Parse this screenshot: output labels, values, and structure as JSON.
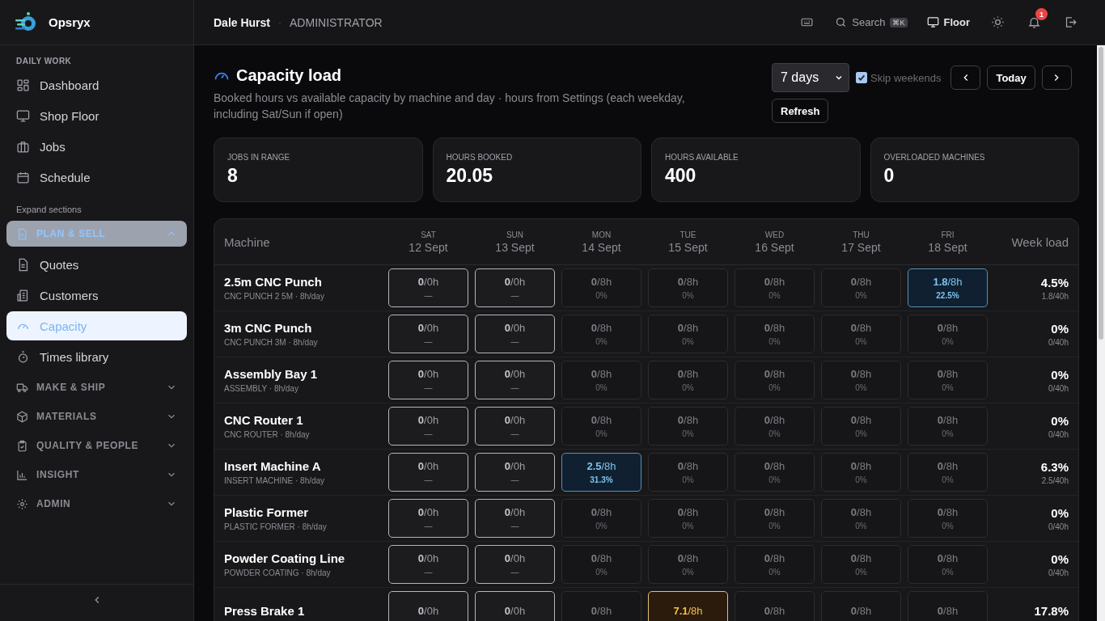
{
  "sidebar": {
    "brand": "Opsryx",
    "daily": {
      "heading": "DAILY WORK",
      "items": [
        {
          "label": "Dashboard",
          "selected": false
        },
        {
          "label": "Shop Floor",
          "selected": false
        },
        {
          "label": "Jobs",
          "selected": false
        },
        {
          "label": "Schedule",
          "selected": false
        }
      ]
    },
    "expand_label": "Expand sections",
    "sections": [
      {
        "label": "PLAN & SELL",
        "expanded": true,
        "items": [
          {
            "label": "Quotes",
            "selected": false
          },
          {
            "label": "Customers",
            "selected": false
          },
          {
            "label": "Capacity",
            "selected": true
          },
          {
            "label": "Times library",
            "selected": false
          }
        ]
      },
      {
        "label": "MAKE & SHIP",
        "expanded": false
      },
      {
        "label": "MATERIALS",
        "expanded": false
      },
      {
        "label": "QUALITY & PEOPLE",
        "expanded": false
      },
      {
        "label": "INSIGHT",
        "expanded": false
      },
      {
        "label": "ADMIN",
        "expanded": false
      }
    ]
  },
  "topbar": {
    "user": "Dale Hurst",
    "separator": "·",
    "role": "ADMINISTRATOR",
    "search": "Search",
    "shortcut": "⌘K",
    "floor": "Floor",
    "notifications": "1"
  },
  "page": {
    "title": "Capacity load",
    "subtitle": "Booked hours vs available capacity by machine and day · hours from Settings (each weekday, including Sat/Sun if open)",
    "range": "7 days",
    "skip_weekends": {
      "label": "Skip weekends",
      "checked": true
    },
    "today": "Today",
    "refresh": "Refresh"
  },
  "stats": [
    {
      "label": "JOBS IN RANGE",
      "value": "8"
    },
    {
      "label": "HOURS BOOKED",
      "value": "20.05"
    },
    {
      "label": "HOURS AVAILABLE",
      "value": "400"
    },
    {
      "label": "OVERLOADED MACHINES",
      "value": "0"
    }
  ],
  "table": {
    "machine_heading": "Machine",
    "load_heading": "Week load",
    "days": [
      {
        "weekday": "SAT",
        "date": "12 Sept"
      },
      {
        "weekday": "SUN",
        "date": "13 Sept"
      },
      {
        "weekday": "MON",
        "date": "14 Sept"
      },
      {
        "weekday": "TUE",
        "date": "15 Sept"
      },
      {
        "weekday": "WED",
        "date": "16 Sept"
      },
      {
        "weekday": "THU",
        "date": "17 Sept"
      },
      {
        "weekday": "FRI",
        "date": "18 Sept"
      }
    ],
    "rows": [
      {
        "name": "2.5m CNC Punch",
        "detail": "CNC PUNCH 2 5M · 8h/day",
        "load": "4.5%",
        "load_detail": "1.8/40h",
        "cells": [
          {
            "kind": "closed",
            "booked": "0",
            "capacity": "/0h",
            "sub": "—"
          },
          {
            "kind": "closed",
            "booked": "0",
            "capacity": "/0h",
            "sub": "—"
          },
          {
            "kind": "idle",
            "booked": "0",
            "capacity": "/8h",
            "sub": "0%"
          },
          {
            "kind": "idle",
            "booked": "0",
            "capacity": "/8h",
            "sub": "0%"
          },
          {
            "kind": "idle",
            "booked": "0",
            "capacity": "/8h",
            "sub": "0%"
          },
          {
            "kind": "idle",
            "booked": "0",
            "capacity": "/8h",
            "sub": "0%"
          },
          {
            "kind": "booked",
            "booked": "1.8",
            "capacity": "/8h",
            "sub": "22.5%"
          }
        ]
      },
      {
        "name": "3m CNC Punch",
        "detail": "CNC PUNCH 3M · 8h/day",
        "load": "0%",
        "load_detail": "0/40h",
        "cells": [
          {
            "kind": "closed",
            "booked": "0",
            "capacity": "/0h",
            "sub": "—"
          },
          {
            "kind": "closed",
            "booked": "0",
            "capacity": "/0h",
            "sub": "—"
          },
          {
            "kind": "idle",
            "booked": "0",
            "capacity": "/8h",
            "sub": "0%"
          },
          {
            "kind": "idle",
            "booked": "0",
            "capacity": "/8h",
            "sub": "0%"
          },
          {
            "kind": "idle",
            "booked": "0",
            "capacity": "/8h",
            "sub": "0%"
          },
          {
            "kind": "idle",
            "booked": "0",
            "capacity": "/8h",
            "sub": "0%"
          },
          {
            "kind": "idle",
            "booked": "0",
            "capacity": "/8h",
            "sub": "0%"
          }
        ]
      },
      {
        "name": "Assembly Bay 1",
        "detail": "ASSEMBLY · 8h/day",
        "load": "0%",
        "load_detail": "0/40h",
        "cells": [
          {
            "kind": "closed",
            "booked": "0",
            "capacity": "/0h",
            "sub": "—"
          },
          {
            "kind": "closed",
            "booked": "0",
            "capacity": "/0h",
            "sub": "—"
          },
          {
            "kind": "idle",
            "booked": "0",
            "capacity": "/8h",
            "sub": "0%"
          },
          {
            "kind": "idle",
            "booked": "0",
            "capacity": "/8h",
            "sub": "0%"
          },
          {
            "kind": "idle",
            "booked": "0",
            "capacity": "/8h",
            "sub": "0%"
          },
          {
            "kind": "idle",
            "booked": "0",
            "capacity": "/8h",
            "sub": "0%"
          },
          {
            "kind": "idle",
            "booked": "0",
            "capacity": "/8h",
            "sub": "0%"
          }
        ]
      },
      {
        "name": "CNC Router 1",
        "detail": "CNC ROUTER · 8h/day",
        "load": "0%",
        "load_detail": "0/40h",
        "cells": [
          {
            "kind": "closed",
            "booked": "0",
            "capacity": "/0h",
            "sub": "—"
          },
          {
            "kind": "closed",
            "booked": "0",
            "capacity": "/0h",
            "sub": "—"
          },
          {
            "kind": "idle",
            "booked": "0",
            "capacity": "/8h",
            "sub": "0%"
          },
          {
            "kind": "idle",
            "booked": "0",
            "capacity": "/8h",
            "sub": "0%"
          },
          {
            "kind": "idle",
            "booked": "0",
            "capacity": "/8h",
            "sub": "0%"
          },
          {
            "kind": "idle",
            "booked": "0",
            "capacity": "/8h",
            "sub": "0%"
          },
          {
            "kind": "idle",
            "booked": "0",
            "capacity": "/8h",
            "sub": "0%"
          }
        ]
      },
      {
        "name": "Insert Machine A",
        "detail": "INSERT MACHINE · 8h/day",
        "load": "6.3%",
        "load_detail": "2.5/40h",
        "cells": [
          {
            "kind": "closed",
            "booked": "0",
            "capacity": "/0h",
            "sub": "—"
          },
          {
            "kind": "closed",
            "booked": "0",
            "capacity": "/0h",
            "sub": "—"
          },
          {
            "kind": "booked",
            "booked": "2.5",
            "capacity": "/8h",
            "sub": "31.3%"
          },
          {
            "kind": "idle",
            "booked": "0",
            "capacity": "/8h",
            "sub": "0%"
          },
          {
            "kind": "idle",
            "booked": "0",
            "capacity": "/8h",
            "sub": "0%"
          },
          {
            "kind": "idle",
            "booked": "0",
            "capacity": "/8h",
            "sub": "0%"
          },
          {
            "kind": "idle",
            "booked": "0",
            "capacity": "/8h",
            "sub": "0%"
          }
        ]
      },
      {
        "name": "Plastic Former",
        "detail": "PLASTIC FORMER · 8h/day",
        "load": "0%",
        "load_detail": "0/40h",
        "cells": [
          {
            "kind": "closed",
            "booked": "0",
            "capacity": "/0h",
            "sub": "—"
          },
          {
            "kind": "closed",
            "booked": "0",
            "capacity": "/0h",
            "sub": "—"
          },
          {
            "kind": "idle",
            "booked": "0",
            "capacity": "/8h",
            "sub": "0%"
          },
          {
            "kind": "idle",
            "booked": "0",
            "capacity": "/8h",
            "sub": "0%"
          },
          {
            "kind": "idle",
            "booked": "0",
            "capacity": "/8h",
            "sub": "0%"
          },
          {
            "kind": "idle",
            "booked": "0",
            "capacity": "/8h",
            "sub": "0%"
          },
          {
            "kind": "idle",
            "booked": "0",
            "capacity": "/8h",
            "sub": "0%"
          }
        ]
      },
      {
        "name": "Powder Coating Line",
        "detail": "POWDER COATING · 8h/day",
        "load": "0%",
        "load_detail": "0/40h",
        "cells": [
          {
            "kind": "closed",
            "booked": "0",
            "capacity": "/0h",
            "sub": "—"
          },
          {
            "kind": "closed",
            "booked": "0",
            "capacity": "/0h",
            "sub": "—"
          },
          {
            "kind": "idle",
            "booked": "0",
            "capacity": "/8h",
            "sub": "0%"
          },
          {
            "kind": "idle",
            "booked": "0",
            "capacity": "/8h",
            "sub": "0%"
          },
          {
            "kind": "idle",
            "booked": "0",
            "capacity": "/8h",
            "sub": "0%"
          },
          {
            "kind": "idle",
            "booked": "0",
            "capacity": "/8h",
            "sub": "0%"
          },
          {
            "kind": "idle",
            "booked": "0",
            "capacity": "/8h",
            "sub": "0%"
          }
        ]
      },
      {
        "name": "Press Brake 1",
        "load": "17.8%",
        "cells": [
          {
            "kind": "closed",
            "booked": "0",
            "capacity": "/0h"
          },
          {
            "kind": "closed",
            "booked": "0",
            "capacity": "/0h"
          },
          {
            "kind": "idle",
            "booked": "0",
            "capacity": "/8h"
          },
          {
            "kind": "warn",
            "booked": "7.1",
            "capacity": "/8h"
          },
          {
            "kind": "idle",
            "booked": "0",
            "capacity": "/8h"
          },
          {
            "kind": "idle",
            "booked": "0",
            "capacity": "/8h"
          },
          {
            "kind": "idle",
            "booked": "0",
            "capacity": "/8h"
          }
        ]
      }
    ]
  }
}
